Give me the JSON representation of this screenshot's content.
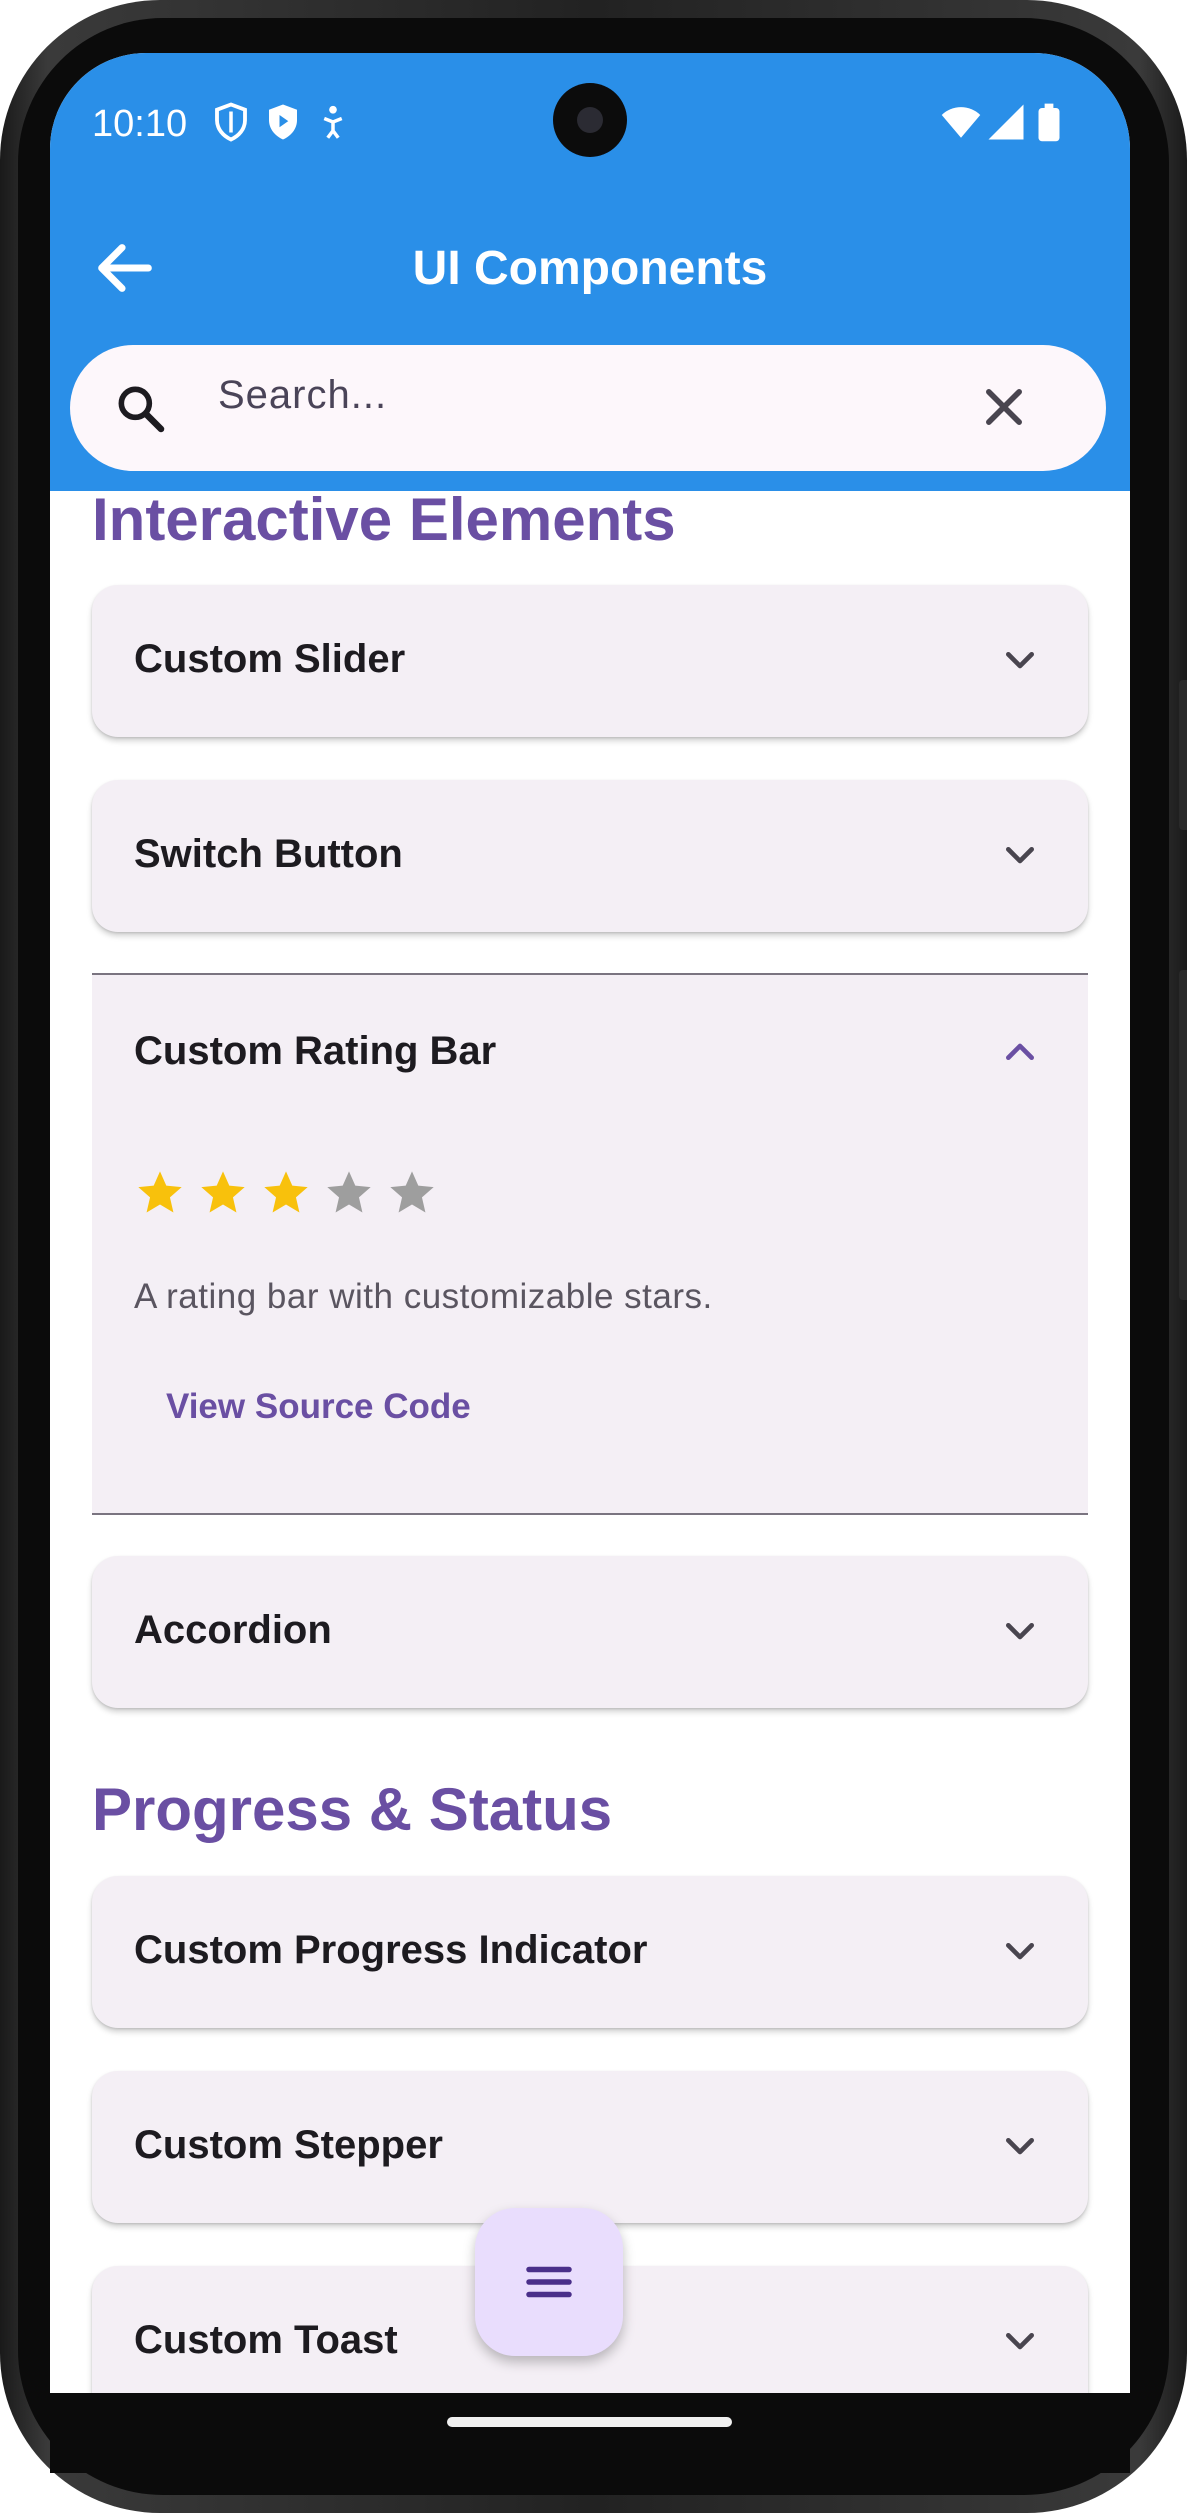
{
  "status_bar": {
    "time": "10:10",
    "icons_left": [
      "shield-outline-icon",
      "shield-play-icon",
      "accessibility-icon"
    ],
    "icons_right": [
      "wifi-icon",
      "signal-icon",
      "battery-icon"
    ]
  },
  "app_bar": {
    "title": "UI Components",
    "background": "#2a8fe8",
    "back_icon": "arrow-back-icon"
  },
  "search": {
    "placeholder": "Search...",
    "value": "",
    "clear_icon": "close-icon"
  },
  "sections": [
    {
      "heading": "Interactive Elements",
      "items": [
        {
          "title": "Custom Slider",
          "expanded": false
        },
        {
          "title": "Switch Button",
          "expanded": false
        },
        {
          "title": "Custom Rating Bar",
          "expanded": true,
          "rating": 3,
          "max_rating": 5,
          "description": "A rating bar with customizable stars.",
          "link": "View Source Code"
        },
        {
          "title": "Accordion",
          "expanded": false
        }
      ]
    },
    {
      "heading": "Progress & Status",
      "items": [
        {
          "title": "Custom Progress Indicator",
          "expanded": false
        },
        {
          "title": "Custom Stepper",
          "expanded": false
        },
        {
          "title": "Custom Toast",
          "expanded": false
        }
      ]
    }
  ],
  "fab": {
    "icon": "menu-icon"
  },
  "colors": {
    "accent": "#6a4fa3",
    "card": "#f4eff5",
    "star_filled": "#f8c10c",
    "star_empty": "#9e9e9e",
    "fab": "#e9ddfd"
  }
}
